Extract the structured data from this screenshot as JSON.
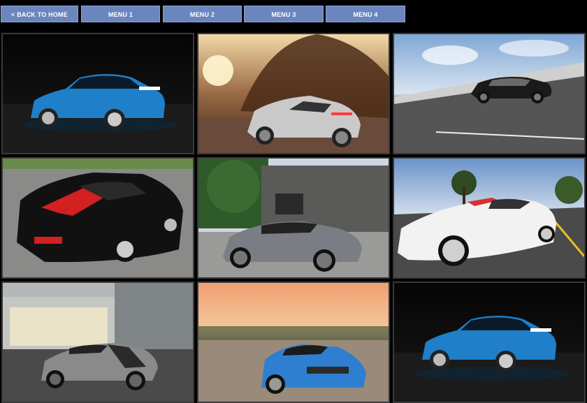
{
  "nav": {
    "back_label": "< BACK TO HOME",
    "menu1_label": "MENU 1",
    "menu2_label": "MENU 2",
    "menu3_label": "MENU 3",
    "menu4_label": "MENU 4"
  },
  "colors": {
    "nav_button": "#6b86be",
    "background": "#000000",
    "tile_border": "#3a3a3a"
  },
  "gallery": [
    {
      "subject": "blue-shelby-mustang-night",
      "body_color": "#1f7fc8",
      "stripe_color": "#ffffff"
    },
    {
      "subject": "silver-audi-roadster-sunset",
      "body_color": "#c9c9c9",
      "stripe_color": "#c9c9c9"
    },
    {
      "subject": "black-bugatti-chiron-road",
      "body_color": "#1a1a1a",
      "stripe_color": "#3a3a3a"
    },
    {
      "subject": "black-red-shelby-gt500",
      "body_color": "#111111",
      "stripe_color": "#d32020"
    },
    {
      "subject": "grey-toyota-concept-building",
      "body_color": "#7a7e84",
      "stripe_color": "#7a7e84"
    },
    {
      "subject": "white-corvette-z06-road",
      "body_color": "#f2f2f2",
      "stripe_color": "#d83030"
    },
    {
      "subject": "grey-mercedes-amg-gt-house",
      "body_color": "#8a8a8a",
      "stripe_color": "#2a2a2a"
    },
    {
      "subject": "blue-bmw-i8-sunset",
      "body_color": "#2f7fd0",
      "stripe_color": "#2f7fd0"
    },
    {
      "subject": "blue-shelby-mustang-night",
      "body_color": "#1f7fc8",
      "stripe_color": "#ffffff"
    }
  ]
}
